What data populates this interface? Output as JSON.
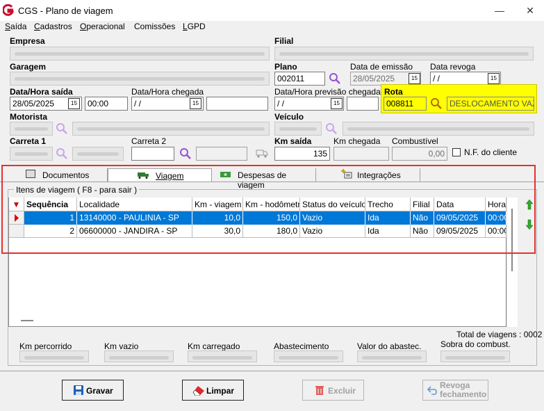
{
  "window": {
    "title": "CGS - Plano de viagem"
  },
  "menu": [
    {
      "label": "Saída",
      "u": "S",
      "rest": "aída"
    },
    {
      "label": "Cadastros",
      "u": "C",
      "rest": "adastros"
    },
    {
      "label": "Operacional",
      "u": "O",
      "rest": "peracional"
    },
    {
      "label": "Comissões",
      "u": "",
      "rest": "Comissões"
    },
    {
      "label": "LGPD",
      "u": "L",
      "rest": "GPD"
    }
  ],
  "labels": {
    "empresa": "Empresa",
    "filial": "Filial",
    "garagem": "Garagem",
    "plano": "Plano",
    "data_emissao": "Data de emissão",
    "data_revoga": "Data revoga",
    "data_hora_saida": "Data/Hora saída",
    "data_hora_chegada": "Data/Hora chegada",
    "data_hora_prev": "Data/Hora previsão chegada",
    "rota": "Rota",
    "motorista": "Motorista",
    "veiculo": "Veículo",
    "carreta1": "Carreta 1",
    "carreta2": "Carreta 2",
    "km_saida": "Km saída",
    "km_chegada": "Km chegada",
    "combustivel": "Combustível",
    "nf_cliente": "N.F. do cliente"
  },
  "fields": {
    "plano": "002011",
    "data_emissao": "28/05/2025",
    "data_revoga": " /  /",
    "data_saida": "28/05/2025",
    "hora_saida": "00:00",
    "data_chegada": " /  /",
    "data_prev": " /  /",
    "rota_codigo": "008811",
    "rota_descricao": "DESLOCAMENTO VAZIO",
    "km_saida": "135",
    "combustivel": "0,00"
  },
  "tabs": [
    {
      "label": "Documentos"
    },
    {
      "label": "Viagem"
    },
    {
      "label": "Despesas de viagem"
    },
    {
      "label": "Integrações"
    }
  ],
  "grid": {
    "caption": "Itens de viagem ( F8 - para sair )",
    "columns": [
      "Sequência",
      "Localidade",
      "Km - viagem",
      "Km - hodômetro",
      "Status do veículo",
      "Trecho",
      "Filial",
      "Data",
      "Hora"
    ],
    "rows": [
      [
        "1",
        "13140000 - PAULINIA - SP",
        "10,0",
        "150,0",
        "Vazio",
        "Ida",
        "Não",
        "09/05/2025",
        "00:00"
      ],
      [
        "2",
        "06600000 - JANDIRA - SP",
        "30,0",
        "180,0",
        "Vazio",
        "Ida",
        "Não",
        "09/05/2025",
        "00:00"
      ]
    ]
  },
  "totals": {
    "total_viagens": "Total de viagens : 0002",
    "km_percorrido": "Km percorrido",
    "km_vazio": "Km vazio",
    "km_carregado": "Km carregado",
    "abastecimento": "Abastecimento",
    "valor_abastec": "Valor do abastec.",
    "sobra_combust": "Sobra do combust."
  },
  "buttons": {
    "gravar": "Gravar",
    "limpar": "Limpar",
    "excluir": "Excluir",
    "revoga_1": "Revoga",
    "revoga_2": "fechamento"
  },
  "colors": {
    "highlight": "#ffff00",
    "annotation": "#e53030",
    "selection": "#0078d7"
  }
}
